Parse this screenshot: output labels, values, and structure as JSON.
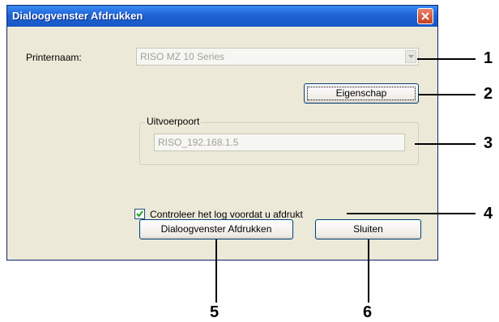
{
  "dialog": {
    "title": "Dialoogvenster Afdrukken",
    "printer_label": "Printernaam:",
    "printer_value": "RISO MZ 10 Series",
    "properties_button": "Eigenschap",
    "port_group_label": "Uitvoerpoort",
    "port_value": "RISO_192.168.1.5",
    "log_check_label": "Controleer het log voordat u afdrukt",
    "log_checked": true,
    "print_dialog_button": "Dialoogvenster Afdrukken",
    "close_button": "Sluiten"
  },
  "callouts": [
    "1",
    "2",
    "3",
    "4",
    "5",
    "6"
  ]
}
